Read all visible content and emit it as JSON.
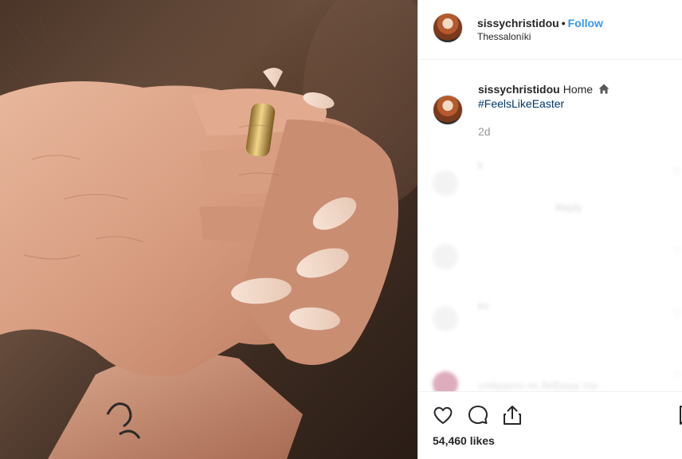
{
  "header": {
    "username": "sissychristidou",
    "separator": "•",
    "follow_label": "Follow",
    "location": "Thessaloníki"
  },
  "caption": {
    "username": "sissychristidou",
    "text": "Home",
    "hashtag": "#FeelsLikeEaster",
    "time": "2d",
    "icon": "home-icon"
  },
  "comments_faded": [
    {
      "user": "k",
      "reply": "Reply"
    },
    {
      "user": "",
      "reply": ""
    },
    {
      "user": "ko",
      "reply": ""
    },
    {
      "user": "",
      "reply": "υπάρχουν σε δείξουμε την"
    }
  ],
  "actions": {
    "icons": [
      "heart-icon",
      "comment-icon",
      "share-icon",
      "bookmark-icon"
    ],
    "likes": "54,460 likes"
  },
  "colors": {
    "link": "#3897f0",
    "hashtag": "#003569",
    "text": "#262626",
    "muted": "#999999"
  }
}
